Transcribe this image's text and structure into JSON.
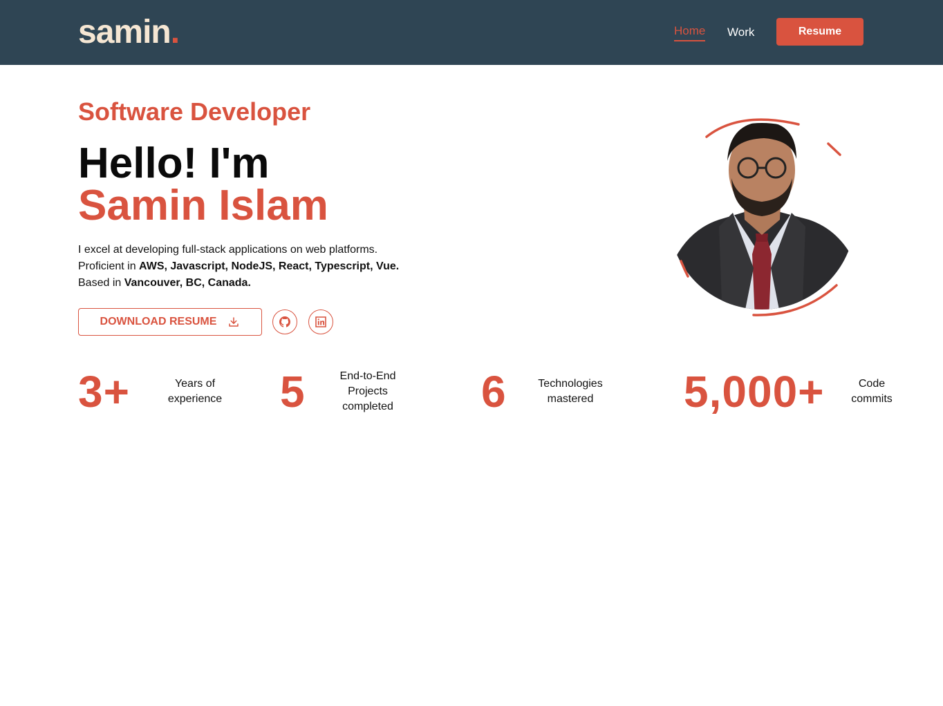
{
  "header": {
    "logo_text": "samin",
    "logo_dot": ".",
    "nav": {
      "home": "Home",
      "work": "Work"
    },
    "resume_button": "Resume"
  },
  "hero": {
    "role": "Software Developer",
    "greeting": "Hello! I'm",
    "name": "Samin Islam",
    "bio_line1": "I excel at developing full-stack applications on web platforms.",
    "bio_line2_prefix": "Proficient in ",
    "bio_line2_bold": "AWS, Javascript, NodeJS, React, Typescript, Vue.",
    "bio_line3_prefix": "Based in ",
    "bio_line3_bold": "Vancouver, BC, Canada.",
    "download_button": "DOWNLOAD RESUME"
  },
  "stats": [
    {
      "value": "3+",
      "label_lines": [
        "Years of",
        "experience"
      ]
    },
    {
      "value": "5",
      "label_lines": [
        "End-to-End",
        "Projects",
        "completed"
      ]
    },
    {
      "value": "6",
      "label_lines": [
        "Technologies",
        "mastered"
      ]
    },
    {
      "value": "5,000+",
      "label_lines": [
        "Code",
        "commits"
      ]
    }
  ],
  "icons": {
    "download": "download-icon",
    "github": "github-icon",
    "linkedin": "linkedin-icon"
  },
  "colors": {
    "accent": "#d9533f",
    "header_bg": "#2f4554",
    "logo": "#f5e6d3"
  }
}
